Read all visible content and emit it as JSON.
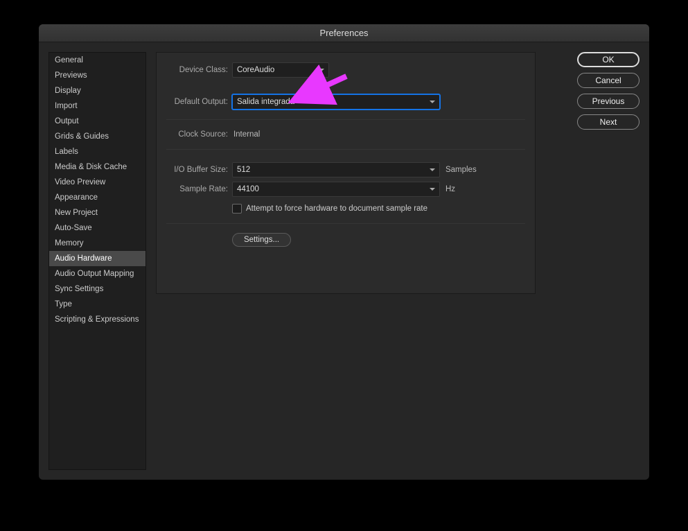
{
  "window": {
    "title": "Preferences"
  },
  "sidebar": {
    "items": [
      "General",
      "Previews",
      "Display",
      "Import",
      "Output",
      "Grids & Guides",
      "Labels",
      "Media & Disk Cache",
      "Video Preview",
      "Appearance",
      "New Project",
      "Auto-Save",
      "Memory",
      "Audio Hardware",
      "Audio Output Mapping",
      "Sync Settings",
      "Type",
      "Scripting & Expressions"
    ],
    "selected_index": 13
  },
  "form": {
    "device_class": {
      "label": "Device Class:",
      "value": "CoreAudio"
    },
    "default_output": {
      "label": "Default Output:",
      "value": "Salida integrada"
    },
    "clock_source": {
      "label": "Clock Source:",
      "value": "Internal"
    },
    "io_buffer": {
      "label": "I/O Buffer Size:",
      "value": "512",
      "unit": "Samples"
    },
    "sample_rate": {
      "label": "Sample Rate:",
      "value": "44100",
      "unit": "Hz"
    },
    "force_hw": {
      "label": "Attempt to force hardware to document sample rate"
    },
    "settings_btn": "Settings..."
  },
  "buttons": {
    "ok": "OK",
    "cancel": "Cancel",
    "previous": "Previous",
    "next": "Next"
  },
  "annotation": {
    "color": "#e838ff"
  }
}
